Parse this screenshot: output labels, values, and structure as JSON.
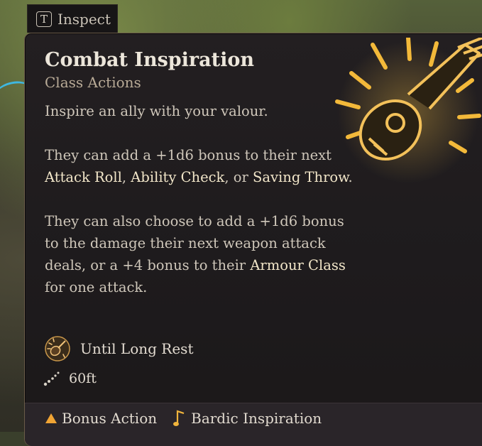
{
  "inspect_tab": {
    "key": "T",
    "label": "Inspect"
  },
  "tooltip": {
    "title": "Combat Inspiration",
    "subtitle": "Class Actions",
    "description": {
      "line1": "Inspire an ally with your valour.",
      "para2_text": "They can add a +1d6 bonus to their next ",
      "para2_hl1": "Attack Roll",
      "para2_sep1": ", ",
      "para2_hl2": "Ability Check",
      "para2_sep2": ", or ",
      "para2_hl3": "Saving Throw",
      "para2_end": ".",
      "para3_text": "They can also choose to add a +1d6 bonus to the damage their next weapon attack deals, or a +4 bonus to their ",
      "para3_hl": "Armour Class",
      "para3_end": " for one attack."
    },
    "recharge": "Until Long Rest",
    "range": "60ft",
    "footer": {
      "cost1": "Bonus Action",
      "cost2": "Bardic Inspiration"
    }
  },
  "colors": {
    "accent_gold": "#f3b93a",
    "highlight_text": "#f2e6c9",
    "panel_bg": "#1e1b1d",
    "rope_blue": "#3fb7e0"
  },
  "icons": [
    "lute-icon",
    "lute-small-icon",
    "range-dots-icon",
    "triangle-icon",
    "music-note-icon"
  ]
}
